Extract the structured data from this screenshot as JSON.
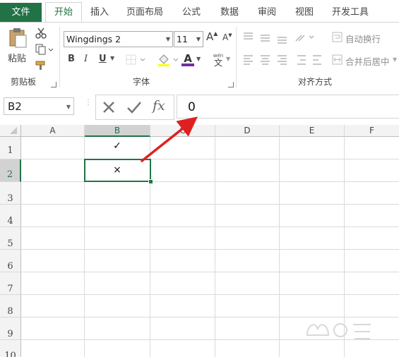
{
  "tabs": [
    {
      "label": "文件"
    },
    {
      "label": "开始"
    },
    {
      "label": "插入"
    },
    {
      "label": "页面布局"
    },
    {
      "label": "公式"
    },
    {
      "label": "数据"
    },
    {
      "label": "审阅"
    },
    {
      "label": "视图"
    },
    {
      "label": "开发工具"
    }
  ],
  "active_tab": "开始",
  "ribbon": {
    "clipboard": {
      "paste_label": "粘贴",
      "group_label": "剪贴板"
    },
    "font": {
      "font_name": "Wingdings 2",
      "font_size": "11",
      "bold": "B",
      "italic": "I",
      "underline": "U",
      "font_color_letter": "A",
      "grow": "A",
      "shrink": "A",
      "wen": "wén",
      "wen_char": "文",
      "group_label": "字体",
      "font_color": "#7030a0"
    },
    "alignment": {
      "wrap_text": "自动换行",
      "merge_center": "合并后居中",
      "group_label": "对齐方式"
    }
  },
  "formula_bar": {
    "name_box": "B2",
    "fx": "fx",
    "value": "0"
  },
  "columns": [
    "A",
    "B",
    "C",
    "D",
    "E",
    "F"
  ],
  "selected_column": "B",
  "rows": [
    "1",
    "2",
    "3",
    "4",
    "5",
    "6",
    "7",
    "8",
    "9",
    "10"
  ],
  "selected_row": "2",
  "cells": {
    "B1": "✓",
    "B2": "×"
  },
  "accent_color": "#217346",
  "annotation_color": "#e02020"
}
